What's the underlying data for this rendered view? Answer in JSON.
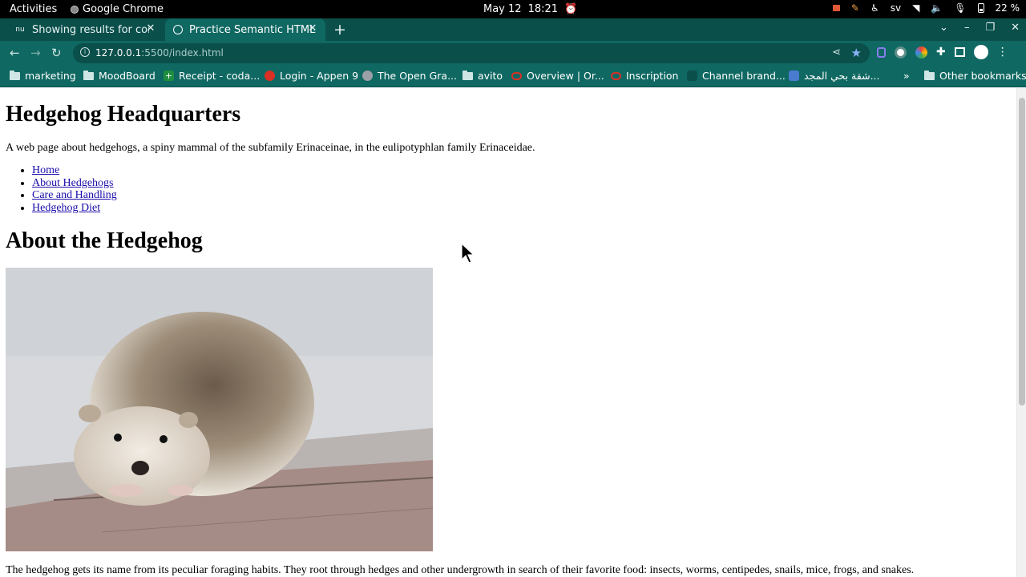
{
  "topbar": {
    "activities": "Activities",
    "app_name": "Google Chrome",
    "date": "May 12",
    "time": "18:21",
    "keyboard_layout": "sv",
    "battery": "22 %"
  },
  "tabs": [
    {
      "title": "Showing results for content",
      "favicon": "nu"
    },
    {
      "title": "Practice Semantic HTML",
      "favicon": "globe-icon"
    }
  ],
  "address_bar": {
    "host": "127.0.0.1",
    "path": ":5500/index.html"
  },
  "bookmarks": [
    {
      "label": "marketing",
      "icon": "folder-icon"
    },
    {
      "label": "MoodBoard",
      "icon": "folder-icon"
    },
    {
      "label": "Receipt - coda...",
      "icon": "plus-icon",
      "color": "#1e8e3e"
    },
    {
      "label": "Login - Appen 9",
      "icon": "appen-icon",
      "color": "#d93025"
    },
    {
      "label": "The Open Gra...",
      "icon": "opengraph-icon",
      "color": "#9aa0a6"
    },
    {
      "label": "avito",
      "icon": "folder-icon"
    },
    {
      "label": "Overview | Or...",
      "icon": "oracle-icon",
      "color": "#d93025"
    },
    {
      "label": "Inscription",
      "icon": "oracle-icon",
      "color": "#d93025"
    },
    {
      "label": "Channel brand...",
      "icon": "channel-icon",
      "color": "#0b4f4b"
    },
    {
      "label": "شقة بحي المجد...",
      "icon": "cube-icon",
      "color": "#4a7bd0"
    }
  ],
  "bookmarks_overflow": "»",
  "other_bookmarks": "Other bookmarks",
  "page": {
    "title": "Hedgehog Headquarters",
    "intro": "A web page about hedgehogs, a spiny mammal of the subfamily Erinaceinae, in the eulipotyphlan family Erinaceidae.",
    "nav": [
      "Home",
      "About Hedgehogs",
      "Care and Handling",
      "Hedgehog Diet"
    ],
    "section_heading": "About the Hedgehog",
    "paragraph": "The hedgehog gets its name from its peculiar foraging habits. They root through hedges and other undergrowth in search of their favorite food: insects, worms, centipedes, snails, mice, frogs, and snakes."
  }
}
